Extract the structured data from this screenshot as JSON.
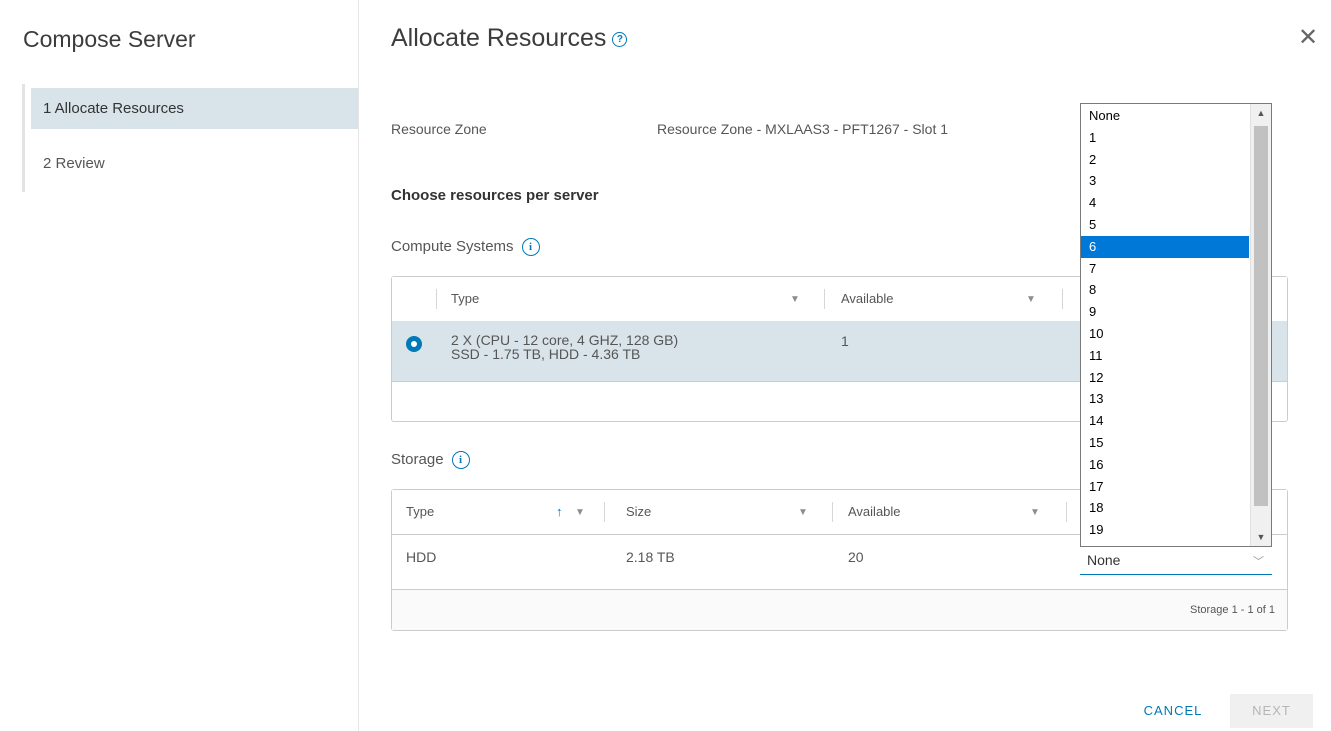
{
  "nav": {
    "title": "Compose Server",
    "steps": [
      {
        "label": "1 Allocate Resources",
        "active": true
      },
      {
        "label": "2 Review",
        "active": false
      }
    ]
  },
  "header": {
    "title": "Allocate Resources",
    "help_icon": "question-circle-icon",
    "close_icon": "close-icon"
  },
  "resource_zone": {
    "label": "Resource Zone",
    "value": "Resource Zone - MXLAAS3 - PFT1267 - Slot 1"
  },
  "section_title": "Choose resources per server",
  "compute": {
    "title": "Compute Systems",
    "columns": [
      "Type",
      "Available"
    ],
    "rows": [
      {
        "type_line1": "2 X (CPU - 12 core, 4 GHZ, 128 GB)",
        "type_line2": "SSD - 1.75 TB, HDD - 4.36 TB",
        "available": "1",
        "selected": true
      }
    ]
  },
  "storage": {
    "title": "Storage",
    "columns": [
      "Type",
      "Size",
      "Available"
    ],
    "rows": [
      {
        "type": "HDD",
        "size": "2.18 TB",
        "available": "20"
      }
    ],
    "footer": "Storage 1 - 1 of 1",
    "select_value": "None"
  },
  "dropdown": {
    "options": [
      "None",
      "1",
      "2",
      "3",
      "4",
      "5",
      "6",
      "7",
      "8",
      "9",
      "10",
      "11",
      "12",
      "13",
      "14",
      "15",
      "16",
      "17",
      "18",
      "19"
    ],
    "highlighted": "6"
  },
  "buttons": {
    "cancel": "CANCEL",
    "next": "NEXT"
  },
  "colors": {
    "accent": "#0079b8",
    "selected_row": "#d9e4ea",
    "dropdown_highlight": "#0078d7"
  }
}
